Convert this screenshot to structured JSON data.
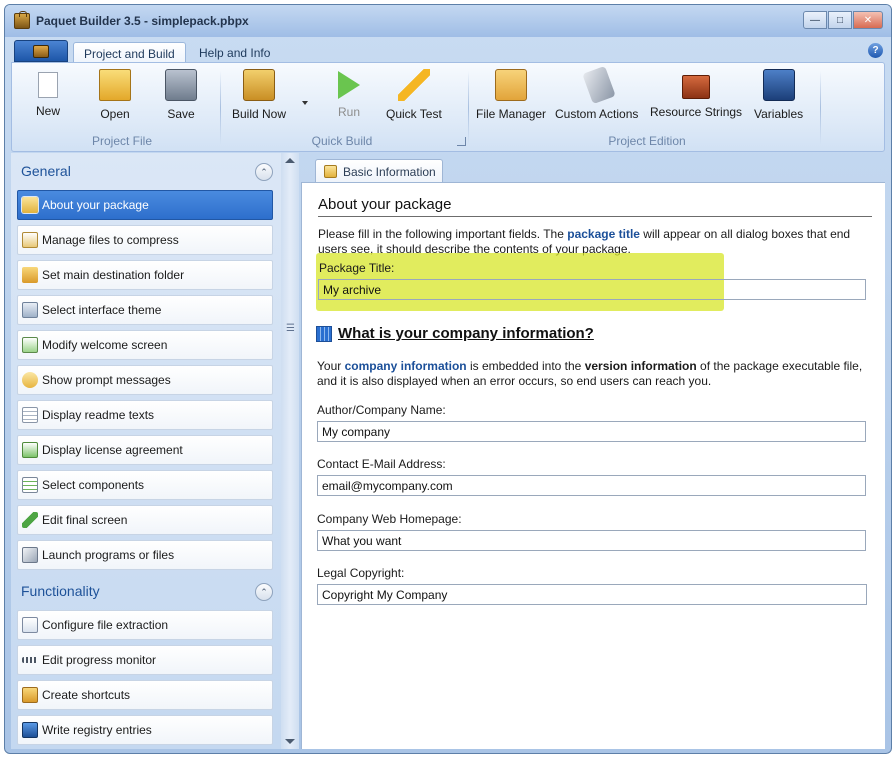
{
  "window": {
    "title": "Paquet Builder 3.5 - simplepack.pbpx"
  },
  "ribbon_tabs": [
    {
      "label": "Project and Build",
      "active": true
    },
    {
      "label": "Help and Info",
      "active": false
    }
  ],
  "ribbon": {
    "new": "New",
    "open": "Open",
    "save": "Save",
    "build_now": "Build Now",
    "run": "Run",
    "quick_test": "Quick Test",
    "file_manager": "File Manager",
    "custom_actions": "Custom Actions",
    "resource_strings": "Resource Strings",
    "variables": "Variables",
    "groups": {
      "project_file": "Project File",
      "quick_build": "Quick Build",
      "project_edition": "Project Edition"
    }
  },
  "sidebar": {
    "general_title": "General",
    "general_items": [
      {
        "label": "About your package",
        "icon": "package-icon",
        "selected": true
      },
      {
        "label": "Manage files to compress",
        "icon": "files-icon",
        "selected": false
      },
      {
        "label": "Set main destination folder",
        "icon": "folder-icon",
        "selected": false
      },
      {
        "label": "Select interface theme",
        "icon": "theme-icon",
        "selected": false
      },
      {
        "label": "Modify welcome screen",
        "icon": "welcome-icon",
        "selected": false
      },
      {
        "label": "Show prompt messages",
        "icon": "message-icon",
        "selected": false
      },
      {
        "label": "Display readme texts",
        "icon": "readme-icon",
        "selected": false
      },
      {
        "label": "Display license agreement",
        "icon": "license-icon",
        "selected": false
      },
      {
        "label": "Select components",
        "icon": "components-icon",
        "selected": false
      },
      {
        "label": "Edit final screen",
        "icon": "final-screen-icon",
        "selected": false
      },
      {
        "label": "Launch programs or files",
        "icon": "launch-icon",
        "selected": false
      }
    ],
    "functionality_title": "Functionality",
    "functionality_items": [
      {
        "label": "Configure file extraction",
        "icon": "extraction-icon"
      },
      {
        "label": "Edit progress monitor",
        "icon": "progress-icon"
      },
      {
        "label": "Create shortcuts",
        "icon": "shortcut-icon"
      },
      {
        "label": "Write registry entries",
        "icon": "registry-icon"
      }
    ]
  },
  "doc_tab": "Basic Information",
  "about": {
    "title": "About your package",
    "desc_before": "Please fill in the following important fields. The ",
    "desc_highlight": "package title",
    "desc_after": " will appear on all dialog boxes that end users see, it should describe the contents of your package.",
    "package_title_label": "Package Title:",
    "package_title_value": "My archive"
  },
  "company": {
    "title": "What is your company information?",
    "desc_1": "Your ",
    "desc_hl": "company information",
    "desc_2": " is embedded into the ",
    "desc_bold": "version information",
    "desc_3": " of the package executable file, and it is also displayed when an error occurs, so end users can reach you.",
    "author_label": "Author/Company Name:",
    "author_value": "My company",
    "email_label": "Contact E-Mail Address:",
    "email_value": "email@mycompany.com",
    "web_label": "Company Web Homepage:",
    "web_value": "What you want",
    "copyright_label": "Legal Copyright:",
    "copyright_value": "Copyright My Company"
  },
  "colors": {
    "accent": "#2d6fcc",
    "highlight": "#d7e628",
    "link": "#1b4f99"
  }
}
